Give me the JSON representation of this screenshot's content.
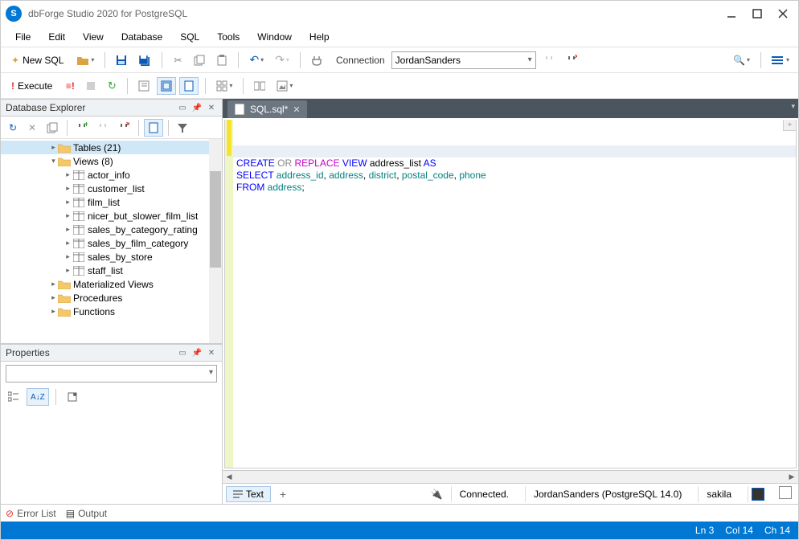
{
  "app": {
    "title": "dbForge Studio 2020 for PostgreSQL",
    "icon_letter": "S"
  },
  "menu": [
    "File",
    "Edit",
    "View",
    "Database",
    "SQL",
    "Tools",
    "Window",
    "Help"
  ],
  "toolbar": {
    "new_sql": "New SQL",
    "connection_label": "Connection",
    "connection_value": "JordanSanders",
    "execute": "Execute"
  },
  "db_explorer": {
    "title": "Database Explorer",
    "tree": [
      {
        "indent": 1,
        "arrow": "▸",
        "icon": "folder",
        "label": "Tables (21)",
        "selected": true
      },
      {
        "indent": 1,
        "arrow": "▴",
        "icon": "folder",
        "label": "Views (8)"
      },
      {
        "indent": 2,
        "arrow": "▸",
        "icon": "view",
        "label": "actor_info"
      },
      {
        "indent": 2,
        "arrow": "▸",
        "icon": "view",
        "label": "customer_list"
      },
      {
        "indent": 2,
        "arrow": "▸",
        "icon": "view",
        "label": "film_list"
      },
      {
        "indent": 2,
        "arrow": "▸",
        "icon": "view",
        "label": "nicer_but_slower_film_list"
      },
      {
        "indent": 2,
        "arrow": "▸",
        "icon": "view",
        "label": "sales_by_category_rating"
      },
      {
        "indent": 2,
        "arrow": "▸",
        "icon": "view",
        "label": "sales_by_film_category"
      },
      {
        "indent": 2,
        "arrow": "▸",
        "icon": "view",
        "label": "sales_by_store"
      },
      {
        "indent": 2,
        "arrow": "▸",
        "icon": "view",
        "label": "staff_list"
      },
      {
        "indent": 1,
        "arrow": "▸",
        "icon": "folder",
        "label": "Materialized Views"
      },
      {
        "indent": 1,
        "arrow": "▸",
        "icon": "folder",
        "label": "Procedures"
      },
      {
        "indent": 1,
        "arrow": "▸",
        "icon": "folder",
        "label": "Functions"
      }
    ]
  },
  "properties": {
    "title": "Properties"
  },
  "editor": {
    "tab_title": "SQL.sql*",
    "sql_tokens": [
      [
        {
          "t": "CREATE",
          "c": "kw"
        },
        {
          "t": " ",
          "c": ""
        },
        {
          "t": "OR",
          "c": "gray"
        },
        {
          "t": " ",
          "c": ""
        },
        {
          "t": "REPLACE",
          "c": "kw2"
        },
        {
          "t": " ",
          "c": ""
        },
        {
          "t": "VIEW",
          "c": "kw"
        },
        {
          "t": " address_list ",
          "c": "ident"
        },
        {
          "t": "AS",
          "c": "kw"
        }
      ],
      [
        {
          "t": "SELECT",
          "c": "kw"
        },
        {
          "t": " address_id",
          "c": "kw3"
        },
        {
          "t": ",",
          "c": "ident"
        },
        {
          "t": " address",
          "c": "kw3"
        },
        {
          "t": ",",
          "c": "ident"
        },
        {
          "t": " district",
          "c": "kw3"
        },
        {
          "t": ",",
          "c": "ident"
        },
        {
          "t": " postal_code",
          "c": "kw3"
        },
        {
          "t": ",",
          "c": "ident"
        },
        {
          "t": " phone",
          "c": "kw3"
        }
      ],
      [
        {
          "t": "FROM",
          "c": "kw"
        },
        {
          "t": " address",
          "c": "kw3"
        },
        {
          "t": ";",
          "c": "ident"
        }
      ]
    ],
    "current_line": 2,
    "status": {
      "text_btn": "Text",
      "connected": "Connected.",
      "server": "JordanSanders (PostgreSQL 14.0)",
      "database": "sakila"
    }
  },
  "bottom_tabs": {
    "error_list": "Error List",
    "output": "Output"
  },
  "statusbar": {
    "ln": "Ln 3",
    "col": "Col 14",
    "ch": "Ch 14"
  }
}
